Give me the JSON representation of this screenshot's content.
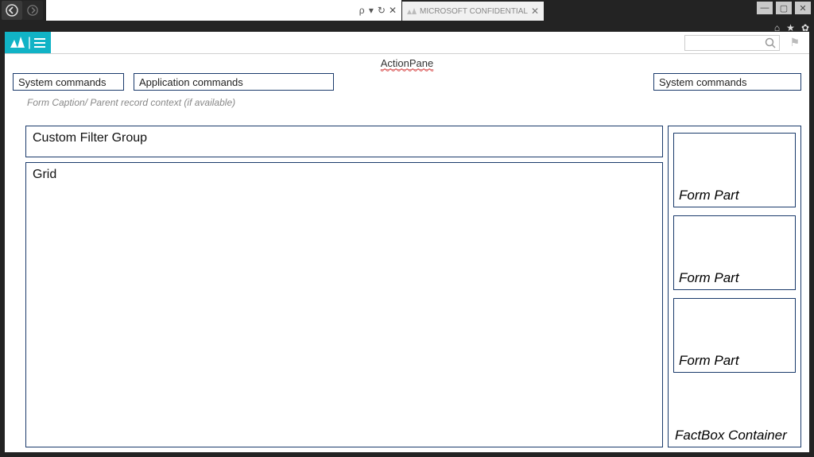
{
  "browser": {
    "addr_suffix": "ρ ▾ ",
    "refresh": "↻",
    "stop": "✕",
    "tab_label": "MICROSOFT CONFIDENTIAL"
  },
  "win": {
    "min": "—",
    "max": "▢",
    "close": "✕"
  },
  "quick": {
    "home": "⌂",
    "star": "★",
    "gear": "✿"
  },
  "appheader": {
    "search_icon": "🔍",
    "flag": "⚑"
  },
  "actionpane": {
    "label": "ActionPane",
    "sys_left": "System commands",
    "app": "Application commands",
    "sys_right": "System commands"
  },
  "caption": "Form Caption/ Parent record context (if available)",
  "panels": {
    "filter": "Custom Filter Group",
    "grid": "Grid"
  },
  "right": {
    "form_part": "Form Part",
    "factbox": "FactBox Container"
  }
}
